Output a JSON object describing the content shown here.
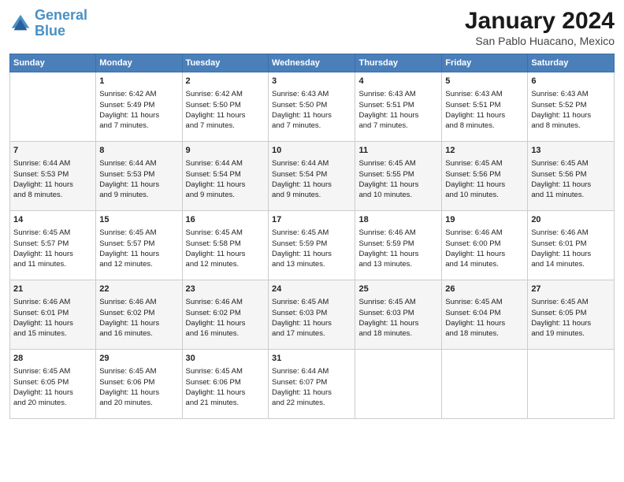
{
  "header": {
    "logo_line1": "General",
    "logo_line2": "Blue",
    "month": "January 2024",
    "location": "San Pablo Huacano, Mexico"
  },
  "columns": [
    "Sunday",
    "Monday",
    "Tuesday",
    "Wednesday",
    "Thursday",
    "Friday",
    "Saturday"
  ],
  "weeks": [
    [
      {
        "day": "",
        "info": ""
      },
      {
        "day": "1",
        "info": "Sunrise: 6:42 AM\nSunset: 5:49 PM\nDaylight: 11 hours\nand 7 minutes."
      },
      {
        "day": "2",
        "info": "Sunrise: 6:42 AM\nSunset: 5:50 PM\nDaylight: 11 hours\nand 7 minutes."
      },
      {
        "day": "3",
        "info": "Sunrise: 6:43 AM\nSunset: 5:50 PM\nDaylight: 11 hours\nand 7 minutes."
      },
      {
        "day": "4",
        "info": "Sunrise: 6:43 AM\nSunset: 5:51 PM\nDaylight: 11 hours\nand 7 minutes."
      },
      {
        "day": "5",
        "info": "Sunrise: 6:43 AM\nSunset: 5:51 PM\nDaylight: 11 hours\nand 8 minutes."
      },
      {
        "day": "6",
        "info": "Sunrise: 6:43 AM\nSunset: 5:52 PM\nDaylight: 11 hours\nand 8 minutes."
      }
    ],
    [
      {
        "day": "7",
        "info": "Sunrise: 6:44 AM\nSunset: 5:53 PM\nDaylight: 11 hours\nand 8 minutes."
      },
      {
        "day": "8",
        "info": "Sunrise: 6:44 AM\nSunset: 5:53 PM\nDaylight: 11 hours\nand 9 minutes."
      },
      {
        "day": "9",
        "info": "Sunrise: 6:44 AM\nSunset: 5:54 PM\nDaylight: 11 hours\nand 9 minutes."
      },
      {
        "day": "10",
        "info": "Sunrise: 6:44 AM\nSunset: 5:54 PM\nDaylight: 11 hours\nand 9 minutes."
      },
      {
        "day": "11",
        "info": "Sunrise: 6:45 AM\nSunset: 5:55 PM\nDaylight: 11 hours\nand 10 minutes."
      },
      {
        "day": "12",
        "info": "Sunrise: 6:45 AM\nSunset: 5:56 PM\nDaylight: 11 hours\nand 10 minutes."
      },
      {
        "day": "13",
        "info": "Sunrise: 6:45 AM\nSunset: 5:56 PM\nDaylight: 11 hours\nand 11 minutes."
      }
    ],
    [
      {
        "day": "14",
        "info": "Sunrise: 6:45 AM\nSunset: 5:57 PM\nDaylight: 11 hours\nand 11 minutes."
      },
      {
        "day": "15",
        "info": "Sunrise: 6:45 AM\nSunset: 5:57 PM\nDaylight: 11 hours\nand 12 minutes."
      },
      {
        "day": "16",
        "info": "Sunrise: 6:45 AM\nSunset: 5:58 PM\nDaylight: 11 hours\nand 12 minutes."
      },
      {
        "day": "17",
        "info": "Sunrise: 6:45 AM\nSunset: 5:59 PM\nDaylight: 11 hours\nand 13 minutes."
      },
      {
        "day": "18",
        "info": "Sunrise: 6:46 AM\nSunset: 5:59 PM\nDaylight: 11 hours\nand 13 minutes."
      },
      {
        "day": "19",
        "info": "Sunrise: 6:46 AM\nSunset: 6:00 PM\nDaylight: 11 hours\nand 14 minutes."
      },
      {
        "day": "20",
        "info": "Sunrise: 6:46 AM\nSunset: 6:01 PM\nDaylight: 11 hours\nand 14 minutes."
      }
    ],
    [
      {
        "day": "21",
        "info": "Sunrise: 6:46 AM\nSunset: 6:01 PM\nDaylight: 11 hours\nand 15 minutes."
      },
      {
        "day": "22",
        "info": "Sunrise: 6:46 AM\nSunset: 6:02 PM\nDaylight: 11 hours\nand 16 minutes."
      },
      {
        "day": "23",
        "info": "Sunrise: 6:46 AM\nSunset: 6:02 PM\nDaylight: 11 hours\nand 16 minutes."
      },
      {
        "day": "24",
        "info": "Sunrise: 6:45 AM\nSunset: 6:03 PM\nDaylight: 11 hours\nand 17 minutes."
      },
      {
        "day": "25",
        "info": "Sunrise: 6:45 AM\nSunset: 6:03 PM\nDaylight: 11 hours\nand 18 minutes."
      },
      {
        "day": "26",
        "info": "Sunrise: 6:45 AM\nSunset: 6:04 PM\nDaylight: 11 hours\nand 18 minutes."
      },
      {
        "day": "27",
        "info": "Sunrise: 6:45 AM\nSunset: 6:05 PM\nDaylight: 11 hours\nand 19 minutes."
      }
    ],
    [
      {
        "day": "28",
        "info": "Sunrise: 6:45 AM\nSunset: 6:05 PM\nDaylight: 11 hours\nand 20 minutes."
      },
      {
        "day": "29",
        "info": "Sunrise: 6:45 AM\nSunset: 6:06 PM\nDaylight: 11 hours\nand 20 minutes."
      },
      {
        "day": "30",
        "info": "Sunrise: 6:45 AM\nSunset: 6:06 PM\nDaylight: 11 hours\nand 21 minutes."
      },
      {
        "day": "31",
        "info": "Sunrise: 6:44 AM\nSunset: 6:07 PM\nDaylight: 11 hours\nand 22 minutes."
      },
      {
        "day": "",
        "info": ""
      },
      {
        "day": "",
        "info": ""
      },
      {
        "day": "",
        "info": ""
      }
    ]
  ]
}
